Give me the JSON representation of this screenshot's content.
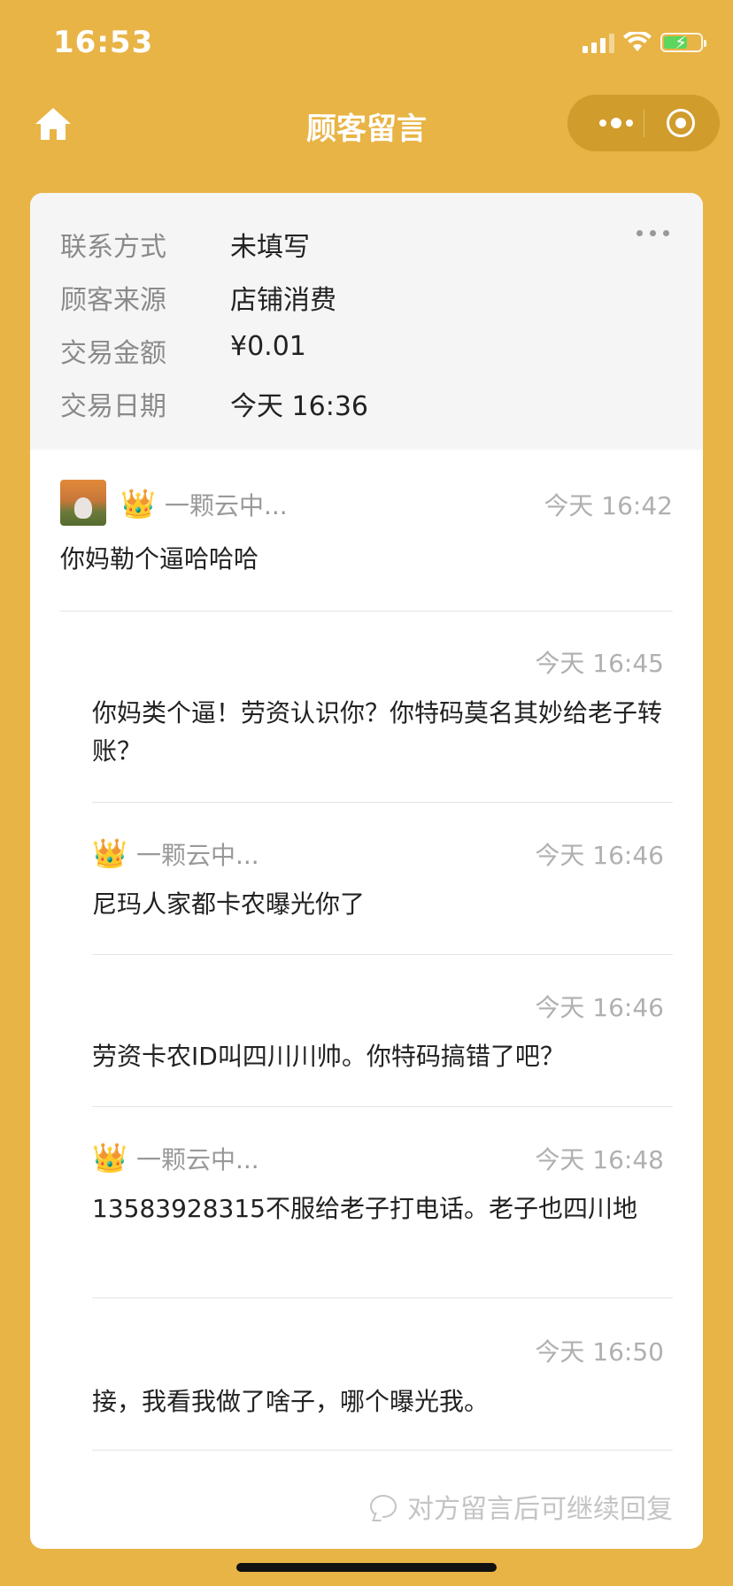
{
  "status_bar": {
    "time": "16:53"
  },
  "nav": {
    "title": "顾客留言"
  },
  "info": {
    "rows": [
      {
        "label": "联系方式",
        "value": "未填写"
      },
      {
        "label": "顾客来源",
        "value": "店铺消费"
      },
      {
        "label": "交易金额",
        "value": "¥0.01"
      },
      {
        "label": "交易日期",
        "value": "今天 16:36"
      }
    ]
  },
  "messages": [
    {
      "name": "一颗云中...",
      "time": "今天 16:42",
      "text": "你妈勒个逼哈哈哈"
    },
    {
      "time": "今天 16:45",
      "text": "你妈类个逼！劳资认识你？你特码莫名其妙给老子转账？"
    },
    {
      "name": "一颗云中...",
      "time": "今天 16:46",
      "text": "尼玛人家都卡农曝光你了"
    },
    {
      "time": "今天 16:46",
      "text": "劳资卡农ID叫四川川帅。你特码搞错了吧？"
    },
    {
      "name": "一颗云中...",
      "time": "今天 16:48",
      "text": "13583928315不服给老子打电话。老子也四川地"
    },
    {
      "time": "今天 16:50",
      "text": "接，我看我做了啥子，哪个曝光我。"
    }
  ],
  "footer": {
    "hint": "对方留言后可继续回复"
  }
}
